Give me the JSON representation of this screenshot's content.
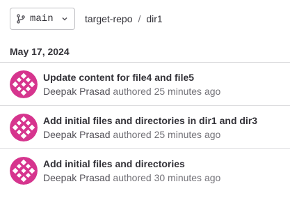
{
  "branch": {
    "name": "main",
    "icon": "branch-icon",
    "dropdown_icon": "chevron-down-icon"
  },
  "breadcrumb": {
    "repo": "target-repo",
    "separator": "/",
    "dir": "dir1"
  },
  "date_group": {
    "label": "May 17, 2024"
  },
  "colors": {
    "avatar": "#d6358e",
    "text": "#333238",
    "muted": "#737278",
    "border": "#dcdcde"
  },
  "commits": [
    {
      "title": "Update content for file4 and file5",
      "author": "Deepak Prasad",
      "action": "authored",
      "time": "25 minutes ago"
    },
    {
      "title": "Add initial files and directories in dir1 and dir3",
      "author": "Deepak Prasad",
      "action": "authored",
      "time": "25 minutes ago"
    },
    {
      "title": "Add initial files and directories",
      "author": "Deepak Prasad",
      "action": "authored",
      "time": "30 minutes ago"
    }
  ]
}
